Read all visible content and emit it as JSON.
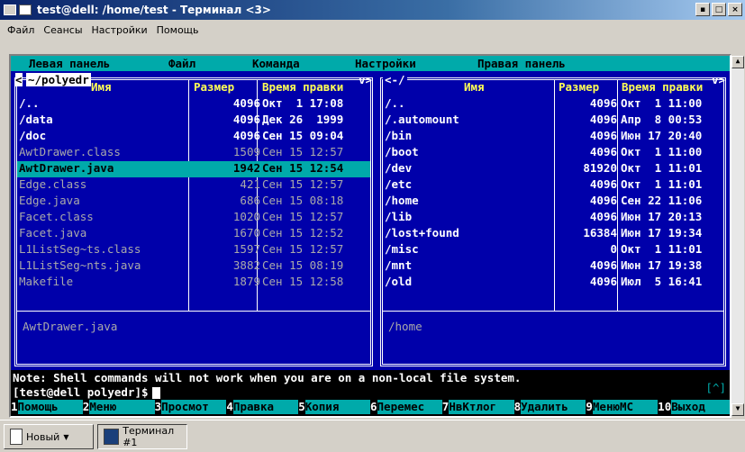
{
  "window": {
    "title": "test@dell: /home/test - Терминал <3>"
  },
  "menubar": [
    "Файл",
    "Сеансы",
    "Настройки",
    "Помощь"
  ],
  "mc_menu": [
    "Левая панель",
    "Файл",
    "Команда",
    "Настройки",
    "Правая панель"
  ],
  "left_panel": {
    "path": "~/polyedr",
    "tab_left": "<",
    "tab_right": "v>",
    "headers": {
      "name": "Имя",
      "size": "Размер",
      "time": "Время правки"
    },
    "rows": [
      {
        "name": "/..",
        "size": "4096",
        "time": "Окт  1 17:08",
        "type": "dir"
      },
      {
        "name": "/data",
        "size": "4096",
        "time": "Дек 26  1999",
        "type": "dir"
      },
      {
        "name": "/doc",
        "size": "4096",
        "time": "Сен 15 09:04",
        "type": "dir"
      },
      {
        "name": "AwtDrawer.class",
        "size": "1509",
        "time": "Сен 15 12:57",
        "type": "file"
      },
      {
        "name": "AwtDrawer.java",
        "size": "1942",
        "time": "Сен 15 12:54",
        "type": "file",
        "selected": true
      },
      {
        "name": "Edge.class",
        "size": "421",
        "time": "Сен 15 12:57",
        "type": "file"
      },
      {
        "name": "Edge.java",
        "size": "686",
        "time": "Сен 15 08:18",
        "type": "file"
      },
      {
        "name": "Facet.class",
        "size": "1020",
        "time": "Сен 15 12:57",
        "type": "file"
      },
      {
        "name": "Facet.java",
        "size": "1670",
        "time": "Сен 15 12:52",
        "type": "file"
      },
      {
        "name": "L1ListSeg~ts.class",
        "size": "1597",
        "time": "Сен 15 12:57",
        "type": "file"
      },
      {
        "name": "L1ListSeg~nts.java",
        "size": "3882",
        "time": "Сен 15 08:19",
        "type": "file"
      },
      {
        "name": "Makefile",
        "size": "1879",
        "time": "Сен 15 12:58",
        "type": "file"
      }
    ],
    "mini_status": "AwtDrawer.java"
  },
  "right_panel": {
    "path": "<-/",
    "tab_right": "v>",
    "headers": {
      "name": "Имя",
      "size": "Размер",
      "time": "Время правки"
    },
    "rows": [
      {
        "name": "/..",
        "size": "4096",
        "time": "Окт  1 11:00"
      },
      {
        "name": "/.automount",
        "size": "4096",
        "time": "Апр  8 00:53"
      },
      {
        "name": "/bin",
        "size": "4096",
        "time": "Июн 17 20:40"
      },
      {
        "name": "/boot",
        "size": "4096",
        "time": "Окт  1 11:00"
      },
      {
        "name": "/dev",
        "size": "81920",
        "time": "Окт  1 11:01"
      },
      {
        "name": "/etc",
        "size": "4096",
        "time": "Окт  1 11:01"
      },
      {
        "name": "/home",
        "size": "4096",
        "time": "Сен 22 11:06"
      },
      {
        "name": "/lib",
        "size": "4096",
        "time": "Июн 17 20:13"
      },
      {
        "name": "/lost+found",
        "size": "16384",
        "time": "Июн 17 19:34"
      },
      {
        "name": "/misc",
        "size": "0",
        "time": "Окт  1 11:01"
      },
      {
        "name": "/mnt",
        "size": "4096",
        "time": "Июн 17 19:38"
      },
      {
        "name": "/old",
        "size": "4096",
        "time": "Июл  5 16:41"
      }
    ],
    "mini_status": "/home"
  },
  "note": "Note: Shell commands will not work when you are on a non-local file system.",
  "prompt": "[test@dell polyedr]$",
  "scroll_indicator": "[^]",
  "keybar": [
    {
      "num": "1",
      "label": "Помощь"
    },
    {
      "num": "2",
      "label": "Меню"
    },
    {
      "num": "3",
      "label": "Просмот"
    },
    {
      "num": "4",
      "label": "Правка"
    },
    {
      "num": "5",
      "label": "Копия"
    },
    {
      "num": "6",
      "label": "Перемес"
    },
    {
      "num": "7",
      "label": "НвКтлог"
    },
    {
      "num": "8",
      "label": "Удалить"
    },
    {
      "num": "9",
      "label": "МенюМС"
    },
    {
      "num": "10",
      "label": "Выход"
    }
  ],
  "taskbar": {
    "new_label": "Новый",
    "terminal_label": "Терминал #1"
  }
}
